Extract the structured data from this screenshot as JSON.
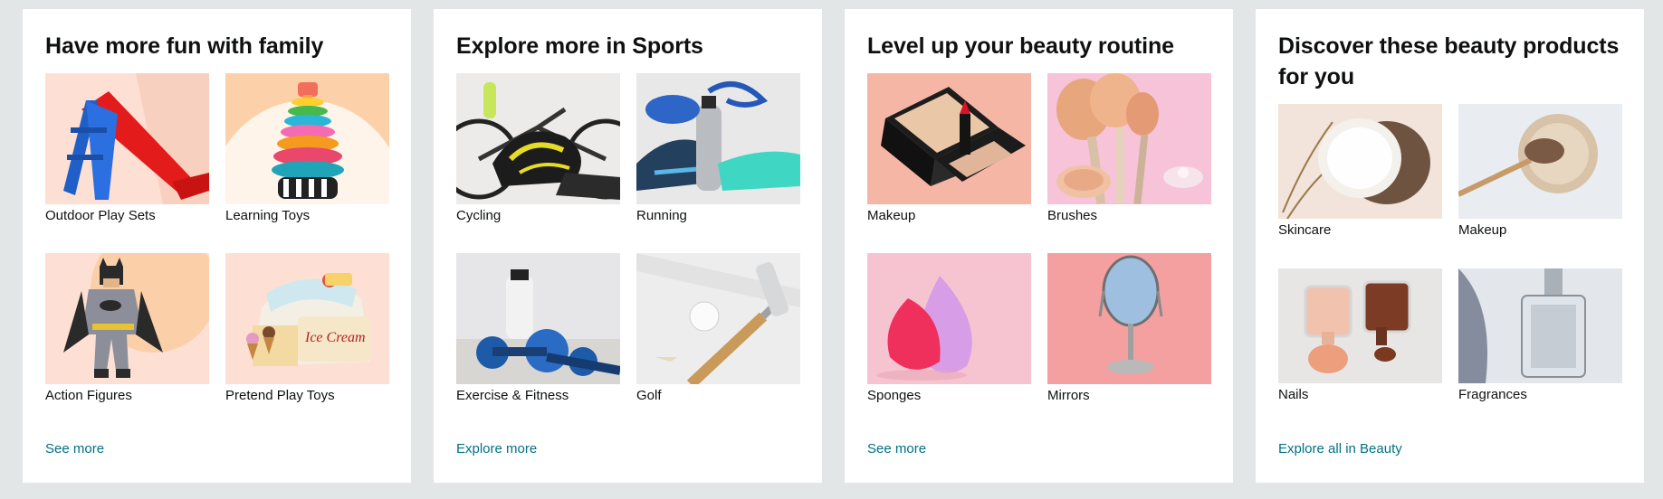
{
  "cards": [
    {
      "title": "Have more fun with family",
      "tiles": [
        {
          "label": "Outdoor Play Sets",
          "icon": "slide-icon"
        },
        {
          "label": "Learning Toys",
          "icon": "stacking-rings-icon"
        },
        {
          "label": "Action Figures",
          "icon": "batman-figure-icon"
        },
        {
          "label": "Pretend Play Toys",
          "icon": "ice-cream-counter-icon"
        }
      ],
      "link": "See more"
    },
    {
      "title": "Explore more in Sports",
      "tiles": [
        {
          "label": "Cycling",
          "icon": "bike-helmet-icon"
        },
        {
          "label": "Running",
          "icon": "running-shoes-icon"
        },
        {
          "label": "Exercise & Fitness",
          "icon": "dumbbells-icon"
        },
        {
          "label": "Golf",
          "icon": "golf-putter-icon"
        }
      ],
      "link": "Explore more"
    },
    {
      "title": "Level up your beauty routine",
      "tiles": [
        {
          "label": "Makeup",
          "icon": "compact-lipstick-icon"
        },
        {
          "label": "Brushes",
          "icon": "makeup-brushes-icon"
        },
        {
          "label": "Sponges",
          "icon": "beauty-sponges-icon"
        },
        {
          "label": "Mirrors",
          "icon": "vanity-mirror-icon"
        }
      ],
      "link": "See more"
    },
    {
      "title": "Discover these beauty products for you",
      "tiles": [
        {
          "label": "Skincare",
          "icon": "cream-jar-icon"
        },
        {
          "label": "Makeup",
          "icon": "powder-brush-icon"
        },
        {
          "label": "Nails",
          "icon": "nail-polish-icon"
        },
        {
          "label": "Fragrances",
          "icon": "perfume-bottle-icon"
        }
      ],
      "link": "Explore all in Beauty"
    }
  ],
  "colors": {
    "page_bg": "#e3e6e6",
    "card_bg": "#ffffff",
    "link": "#007185",
    "text": "#0f1111"
  }
}
